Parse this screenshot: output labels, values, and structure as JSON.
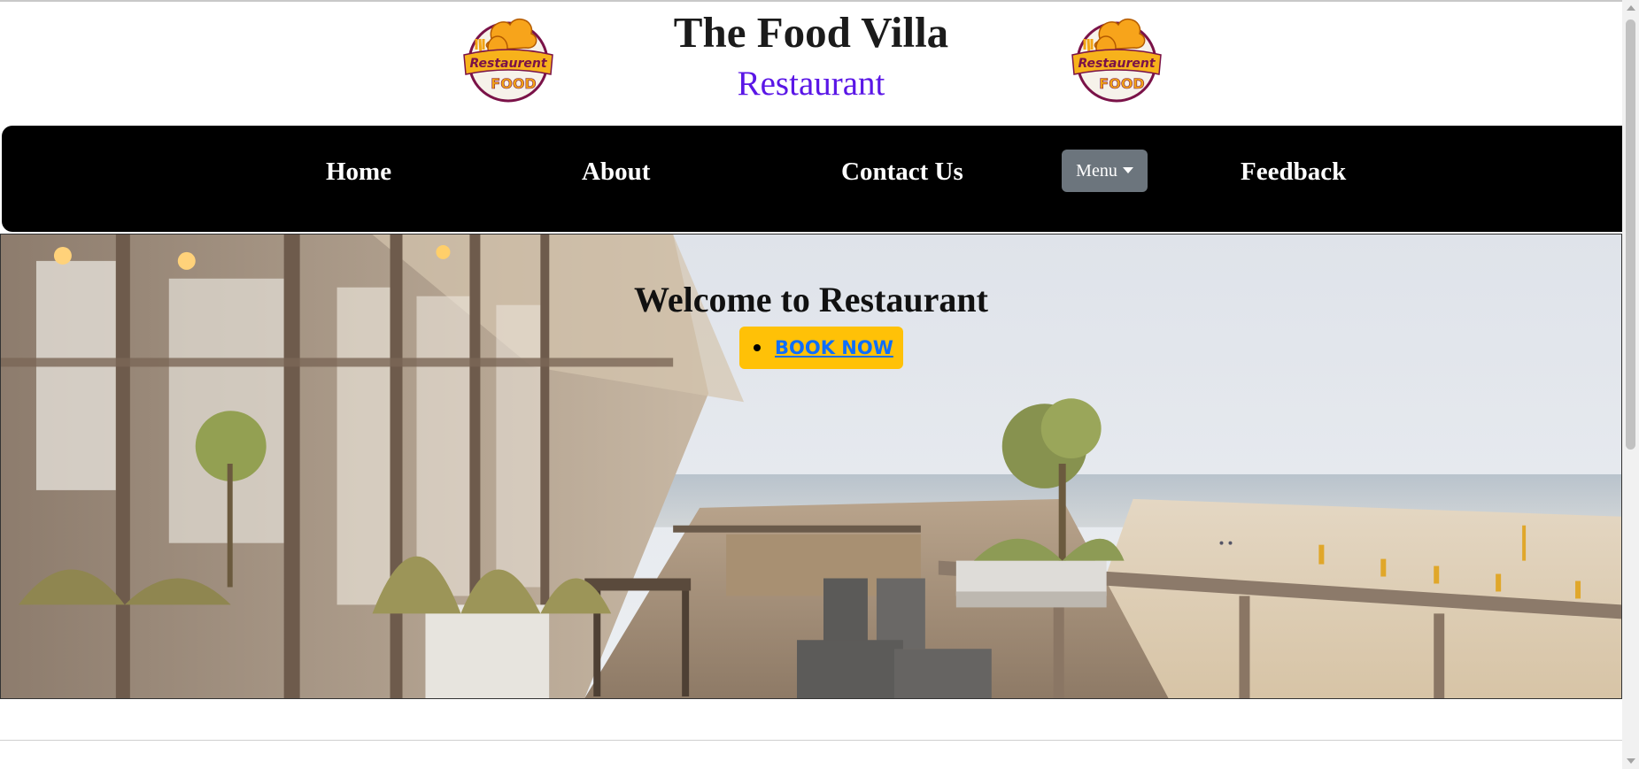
{
  "header": {
    "title": "The Food Villa",
    "subtitle": "Restaurant",
    "logo": {
      "line1": "Restaurent",
      "line2": "FOOD",
      "icon": "chef-hat-logo"
    }
  },
  "nav": {
    "home": "Home",
    "about": "About",
    "contact": "Contact Us",
    "menu": "Menu",
    "feedback": "Feedback"
  },
  "hero": {
    "title": "Welcome to Restaurant",
    "book_now": "BOOK NOW"
  },
  "colors": {
    "navbar": "#000000",
    "subtitle": "#5a16e6",
    "menu_button": "#6c757d",
    "book_button": "#ffc107",
    "book_link": "#0d6efd"
  }
}
